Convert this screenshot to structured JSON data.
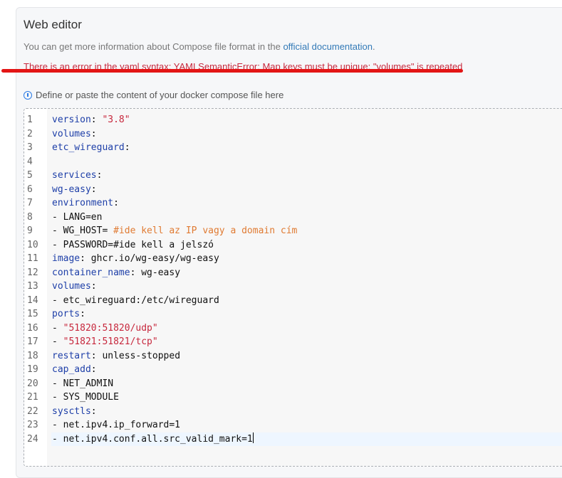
{
  "header": {
    "title": "Web editor",
    "info_prefix": "You can get more information about Compose file format in the ",
    "info_link": "official documentation",
    "info_suffix": "."
  },
  "error": {
    "message": "There is an error in the yaml syntax: YAMLSemanticError: Map keys must be unique; \"volumes\" is repeated"
  },
  "hint": {
    "icon": "info-circle-icon",
    "text": "Define or paste the content of your docker compose file here"
  },
  "editor": {
    "lines": [
      [
        {
          "t": "k",
          "v": "version"
        },
        {
          "t": "p",
          "v": ": "
        },
        {
          "t": "s",
          "v": "\"3.8\""
        }
      ],
      [
        {
          "t": "k",
          "v": "volumes"
        },
        {
          "t": "p",
          "v": ":"
        }
      ],
      [
        {
          "t": "k",
          "v": "etc_wireguard"
        },
        {
          "t": "p",
          "v": ":"
        }
      ],
      [],
      [
        {
          "t": "k",
          "v": "services"
        },
        {
          "t": "p",
          "v": ":"
        }
      ],
      [
        {
          "t": "k",
          "v": "wg-easy"
        },
        {
          "t": "p",
          "v": ":"
        }
      ],
      [
        {
          "t": "k",
          "v": "environment"
        },
        {
          "t": "p",
          "v": ":"
        }
      ],
      [
        {
          "t": "p",
          "v": "- LANG=en"
        }
      ],
      [
        {
          "t": "p",
          "v": "- WG_HOST= "
        },
        {
          "t": "c",
          "v": "#ide kell az IP vagy a domain cím"
        }
      ],
      [
        {
          "t": "p",
          "v": "- PASSWORD=#ide kell a jelszó"
        }
      ],
      [
        {
          "t": "k",
          "v": "image"
        },
        {
          "t": "p",
          "v": ": ghcr.io/wg-easy/wg-easy"
        }
      ],
      [
        {
          "t": "k",
          "v": "container_name"
        },
        {
          "t": "p",
          "v": ": wg-easy"
        }
      ],
      [
        {
          "t": "k",
          "v": "volumes"
        },
        {
          "t": "p",
          "v": ":"
        }
      ],
      [
        {
          "t": "p",
          "v": "- etc_wireguard:/etc/wireguard"
        }
      ],
      [
        {
          "t": "k",
          "v": "ports"
        },
        {
          "t": "p",
          "v": ":"
        }
      ],
      [
        {
          "t": "p",
          "v": "- "
        },
        {
          "t": "s",
          "v": "\"51820:51820/udp\""
        }
      ],
      [
        {
          "t": "p",
          "v": "- "
        },
        {
          "t": "s",
          "v": "\"51821:51821/tcp\""
        }
      ],
      [
        {
          "t": "k",
          "v": "restart"
        },
        {
          "t": "p",
          "v": ": unless-stopped"
        }
      ],
      [
        {
          "t": "k",
          "v": "cap_add"
        },
        {
          "t": "p",
          "v": ":"
        }
      ],
      [
        {
          "t": "p",
          "v": "- NET_ADMIN"
        }
      ],
      [
        {
          "t": "p",
          "v": "- SYS_MODULE"
        }
      ],
      [
        {
          "t": "k",
          "v": "sysctls"
        },
        {
          "t": "p",
          "v": ":"
        }
      ],
      [
        {
          "t": "p",
          "v": "- net.ipv4.ip_forward=1"
        }
      ],
      [
        {
          "t": "p",
          "v": "- net.ipv4.conf.all.src_valid_mark=1"
        }
      ]
    ],
    "active_line": 24
  },
  "colors": {
    "key": "#1e3fa8",
    "string": "#c7283d",
    "comment": "#e07b33",
    "error": "#c7283d",
    "link": "#337ab7"
  }
}
